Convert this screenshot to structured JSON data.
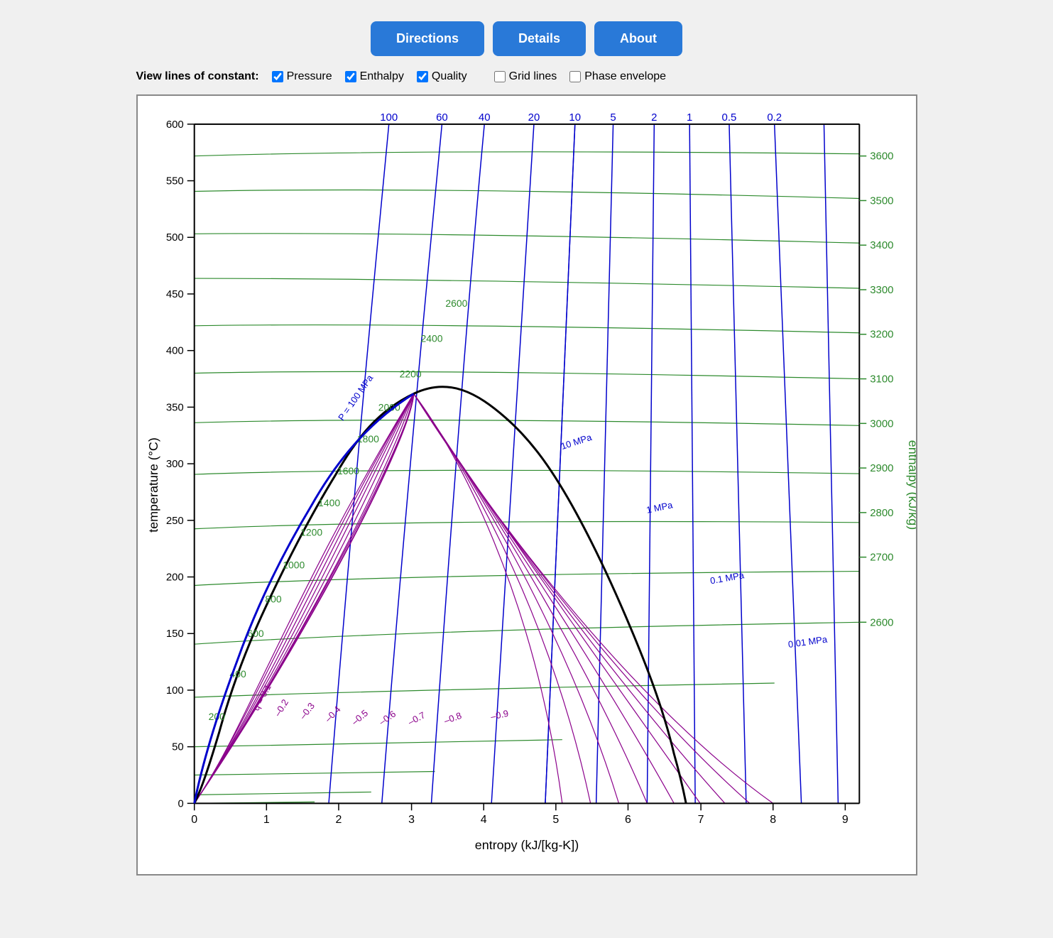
{
  "buttons": {
    "directions": "Directions",
    "details": "Details",
    "about": "About"
  },
  "viewOptions": {
    "label": "View lines of constant:",
    "pressure": {
      "label": "Pressure",
      "checked": true
    },
    "enthalpy": {
      "label": "Enthalpy",
      "checked": true
    },
    "quality": {
      "label": "Quality",
      "checked": true
    },
    "gridLines": {
      "label": "Grid lines",
      "checked": false
    },
    "phaseEnvelope": {
      "label": "Phase envelope",
      "checked": false
    }
  },
  "chart": {
    "xAxisLabel": "entropy (kJ/[kg-K])",
    "yAxisLeftLabel": "temperature (°C)",
    "yAxisRightLabel": "enthalpy (kJ/kg)",
    "xTicks": [
      0,
      1,
      2,
      3,
      4,
      5,
      6,
      7,
      8,
      9
    ],
    "yTicksLeft": [
      0,
      50,
      100,
      150,
      200,
      250,
      300,
      350,
      400,
      450,
      500,
      550,
      600
    ],
    "yTicksRight": [
      2600,
      2700,
      2800,
      2900,
      3000,
      3100,
      3200,
      3300,
      3400,
      3500,
      3600
    ],
    "pressureLabels": [
      "100",
      "60",
      "40",
      "20",
      "10",
      "5",
      "2",
      "1",
      "0.5",
      "0.2"
    ],
    "enthalpyLabels": [
      "200",
      "400",
      "600",
      "800",
      "1000",
      "1200",
      "1400",
      "1600",
      "1800",
      "2000",
      "2200",
      "2400",
      "2600"
    ],
    "qualityLabels": [
      "q = 0.1",
      "–0.2",
      "–0.3",
      "–0.4",
      "–0.5",
      "–0.6",
      "–0.7",
      "–0.8",
      "–0.9"
    ],
    "pressureLineLabels": [
      "P = 100 MPa",
      "10 MPa",
      "1 MPa",
      "0.1 MPa",
      "0.01 MPa"
    ]
  }
}
